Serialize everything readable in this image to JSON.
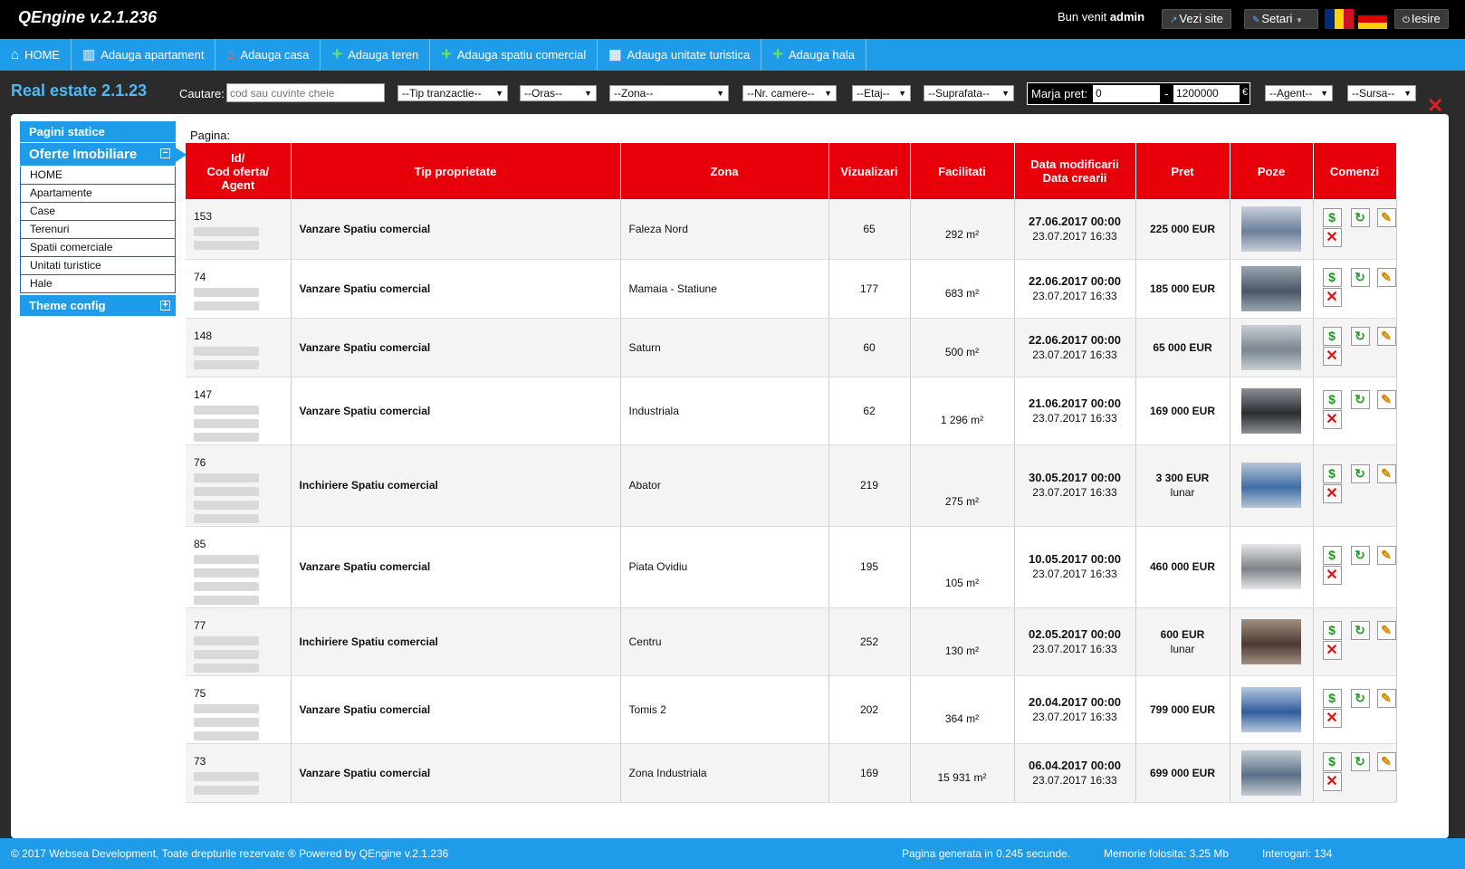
{
  "topbar": {
    "brand": "QEngine v.2.1.236",
    "welcome": "Bun venit",
    "user": "admin",
    "view_site": "Vezi site",
    "settings": "Setari",
    "logout": "Iesire",
    "flag_ro_colors": [
      "#002b7f",
      "#fcd116",
      "#ce1126"
    ],
    "flag_de_colors": [
      "#000000",
      "#dd0000",
      "#ffce00"
    ]
  },
  "nav": {
    "items": [
      {
        "label": "HOME",
        "icon": "home-icon"
      },
      {
        "label": "Adauga apartament",
        "icon": "building-icon"
      },
      {
        "label": "Adauga casa",
        "icon": "house-icon"
      },
      {
        "label": "Adauga teren",
        "icon": "plus-icon"
      },
      {
        "label": "Adauga spatiu comercial",
        "icon": "plus-icon"
      },
      {
        "label": "Adauga unitate turistica",
        "icon": "hotel-icon"
      },
      {
        "label": "Adauga hala",
        "icon": "plus-icon"
      }
    ]
  },
  "filters": {
    "title": "Real estate 2.1.23",
    "search_label": "Cautare:",
    "search_placeholder": "cod sau cuvinte cheie",
    "tip_tranzactie": "--Tip tranzactie--",
    "oras": "--Oras--",
    "zona": "--Zona--",
    "nr_camere": "--Nr. camere--",
    "etaj": "--Etaj--",
    "suprafata": "--Suprafata--",
    "marja_label": "Marja pret:",
    "price_min": "0",
    "price_max": "1200000",
    "currency": "€",
    "agent": "--Agent--",
    "sursa": "--Sursa--"
  },
  "sidebar": {
    "static_pages": "Pagini statice",
    "oferte": "Oferte Imobiliare",
    "items": [
      "HOME",
      "Apartamente",
      "Case",
      "Terenuri",
      "Spatii comerciale",
      "Unitati turistice",
      "Hale"
    ],
    "theme_config": "Theme config"
  },
  "main": {
    "pagina_label": "Pagina:",
    "headers": {
      "id_l1": "Id/",
      "id_l2": "Cod oferta/",
      "id_l3": "Agent",
      "tip": "Tip proprietate",
      "zona": "Zona",
      "viz": "Vizualizari",
      "fac": "Facilitati",
      "date_l1": "Data modificarii",
      "date_l2": "Data crearii",
      "pret": "Pret",
      "poze": "Poze",
      "cmd": "Comenzi"
    },
    "rows": [
      {
        "id": "153",
        "tip": "Vanzare Spatiu comercial",
        "zona": "Faleza Nord",
        "viz": "65",
        "fac": "292 m²",
        "mod": "27.06.2017 00:00",
        "cre": "23.07.2017 16:33",
        "pret": "225 000 EUR",
        "pret_sub": "",
        "blur": 2
      },
      {
        "id": "74",
        "tip": "Vanzare Spatiu comercial",
        "zona": "Mamaia - Statiune",
        "viz": "177",
        "fac": "683 m²",
        "mod": "22.06.2017 00:00",
        "cre": "23.07.2017 16:33",
        "pret": "185 000 EUR",
        "pret_sub": "",
        "blur": 2
      },
      {
        "id": "148",
        "tip": "Vanzare Spatiu comercial",
        "zona": "Saturn",
        "viz": "60",
        "fac": "500 m²",
        "mod": "22.06.2017 00:00",
        "cre": "23.07.2017 16:33",
        "pret": "65 000 EUR",
        "pret_sub": "",
        "blur": 2
      },
      {
        "id": "147",
        "tip": "Vanzare Spatiu comercial",
        "zona": "Industriala",
        "viz": "62",
        "fac": "1 296 m²",
        "mod": "21.06.2017 00:00",
        "cre": "23.07.2017 16:33",
        "pret": "169 000 EUR",
        "pret_sub": "",
        "blur": 3
      },
      {
        "id": "76",
        "tip": "Inchiriere Spatiu comercial",
        "zona": "Abator",
        "viz": "219",
        "fac": "275 m²",
        "mod": "30.05.2017 00:00",
        "cre": "23.07.2017 16:33",
        "pret": "3 300 EUR",
        "pret_sub": "lunar",
        "blur": 4
      },
      {
        "id": "85",
        "tip": "Vanzare Spatiu comercial",
        "zona": "Piata Ovidiu",
        "viz": "195",
        "fac": "105 m²",
        "mod": "10.05.2017 00:00",
        "cre": "23.07.2017 16:33",
        "pret": "460 000 EUR",
        "pret_sub": "",
        "blur": 4
      },
      {
        "id": "77",
        "tip": "Inchiriere Spatiu comercial",
        "zona": "Centru",
        "viz": "252",
        "fac": "130 m²",
        "mod": "02.05.2017 00:00",
        "cre": "23.07.2017 16:33",
        "pret": "600 EUR",
        "pret_sub": "lunar",
        "blur": 3
      },
      {
        "id": "75",
        "tip": "Vanzare Spatiu comercial",
        "zona": "Tomis 2",
        "viz": "202",
        "fac": "364 m²",
        "mod": "20.04.2017 00:00",
        "cre": "23.07.2017 16:33",
        "pret": "799 000 EUR",
        "pret_sub": "",
        "blur": 3
      },
      {
        "id": "73",
        "tip": "Vanzare Spatiu comercial",
        "zona": "Zona Industriala",
        "viz": "169",
        "fac": "15 931 m²",
        "mod": "06.04.2017 00:00",
        "cre": "23.07.2017 16:33",
        "pret": "699 000 EUR",
        "pret_sub": "",
        "blur": 2
      }
    ]
  },
  "footer": {
    "copyright": "© 2017 Websea Development, Toate drepturile rezervate ® Powered by QEngine v.2.1.236",
    "generated": "Pagina generata in 0.245 secunde.",
    "memory": "Memorie folosita: 3.25 Mb",
    "queries": "Interogari: 134"
  },
  "colors": {
    "accent_blue": "#1e9be9",
    "header_red": "#e7000a",
    "title_blue": "#4fb8f5"
  }
}
